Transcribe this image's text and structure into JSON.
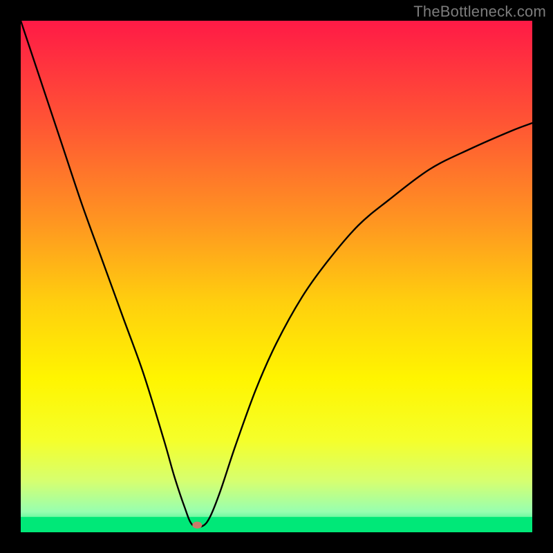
{
  "watermark": "TheBottleneck.com",
  "chart_data": {
    "type": "line",
    "title": "",
    "xlabel": "",
    "ylabel": "",
    "xlim": [
      0,
      100
    ],
    "ylim": [
      0,
      100
    ],
    "grid": false,
    "legend": false,
    "background_gradient": {
      "stops": [
        {
          "offset": 0.0,
          "color": "#ff1a46"
        },
        {
          "offset": 0.2,
          "color": "#ff5534"
        },
        {
          "offset": 0.4,
          "color": "#ff9820"
        },
        {
          "offset": 0.55,
          "color": "#ffcf0e"
        },
        {
          "offset": 0.7,
          "color": "#fff500"
        },
        {
          "offset": 0.82,
          "color": "#f5ff2a"
        },
        {
          "offset": 0.9,
          "color": "#d6ff70"
        },
        {
          "offset": 0.96,
          "color": "#97ffb0"
        },
        {
          "offset": 1.0,
          "color": "#00e878"
        }
      ]
    },
    "green_band_y": [
      0,
      3
    ],
    "series": [
      {
        "name": "curve",
        "x": [
          0,
          4,
          8,
          12,
          16,
          20,
          24,
          28,
          30,
          32,
          33.5,
          35.5,
          37,
          39,
          42,
          46,
          50,
          55,
          60,
          66,
          72,
          80,
          88,
          96,
          100
        ],
        "y": [
          100,
          88,
          76,
          64,
          53,
          42,
          31,
          18,
          11,
          5,
          1.5,
          1.2,
          3,
          8,
          17,
          28,
          37,
          46,
          53,
          60,
          65,
          71,
          75,
          78.5,
          80
        ]
      }
    ],
    "marker": {
      "x": 34.5,
      "y": 1.4,
      "color": "#c97a6a",
      "rx": 7,
      "ry": 5
    }
  }
}
